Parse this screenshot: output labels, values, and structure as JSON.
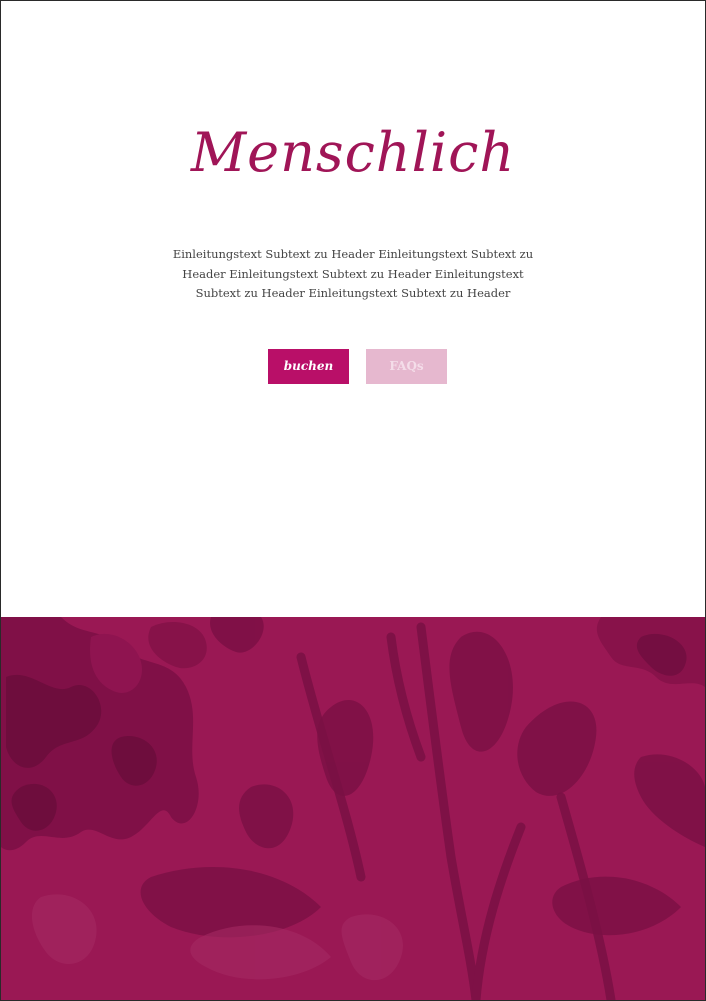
{
  "hero": {
    "title": "Menschlich",
    "intro": "Einleitungstext Subtext zu Header Einleitungstext Subtext zu Header Einleitungstext Subtext zu Header Einleitungstext Subtext zu Header Einleitungstext Subtext zu Header"
  },
  "buttons": {
    "primary_label": "buchen",
    "secondary_label": "FAQs"
  },
  "footer": {
    "background_color": "#9a1854",
    "image": "floral-watercolor-illustration"
  }
}
